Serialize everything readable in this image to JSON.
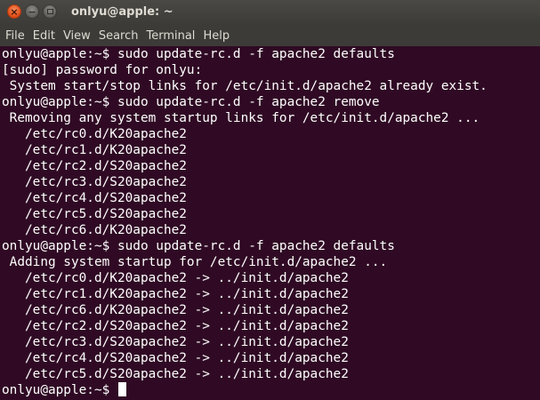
{
  "window": {
    "title": "onlyu@apple: ~",
    "close_glyph": "×",
    "minimize_glyph": "−"
  },
  "menubar": {
    "items": [
      "File",
      "Edit",
      "View",
      "Search",
      "Terminal",
      "Help"
    ]
  },
  "terminal": {
    "lines": [
      "onlyu@apple:~$ sudo update-rc.d -f apache2 defaults",
      "[sudo] password for onlyu:",
      " System start/stop links for /etc/init.d/apache2 already exist.",
      "onlyu@apple:~$ sudo update-rc.d -f apache2 remove",
      " Removing any system startup links for /etc/init.d/apache2 ...",
      "   /etc/rc0.d/K20apache2",
      "   /etc/rc1.d/K20apache2",
      "   /etc/rc2.d/S20apache2",
      "   /etc/rc3.d/S20apache2",
      "   /etc/rc4.d/S20apache2",
      "   /etc/rc5.d/S20apache2",
      "   /etc/rc6.d/K20apache2",
      "onlyu@apple:~$ sudo update-rc.d -f apache2 defaults",
      " Adding system startup for /etc/init.d/apache2 ...",
      "   /etc/rc0.d/K20apache2 -> ../init.d/apache2",
      "   /etc/rc1.d/K20apache2 -> ../init.d/apache2",
      "   /etc/rc6.d/K20apache2 -> ../init.d/apache2",
      "   /etc/rc2.d/S20apache2 -> ../init.d/apache2",
      "   /etc/rc3.d/S20apache2 -> ../init.d/apache2",
      "   /etc/rc4.d/S20apache2 -> ../init.d/apache2",
      "   /etc/rc5.d/S20apache2 -> ../init.d/apache2"
    ],
    "prompt": "onlyu@apple:~$ "
  },
  "colors": {
    "terminal_bg": "#300a24",
    "terminal_fg": "#ffffff",
    "titlebar_bg": "#3c3b37",
    "close_button": "#df4a16"
  },
  "icons": {
    "close": "close-icon",
    "minimize": "minimize-icon",
    "maximize": "maximize-icon"
  }
}
